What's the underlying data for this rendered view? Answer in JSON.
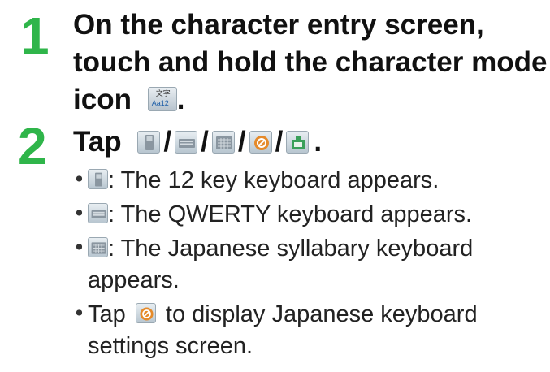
{
  "step1": {
    "number": "1",
    "line1": "On the character entry screen,",
    "line2": "touch and hold the character mode",
    "line3_prefix": "icon",
    "line3_suffix": ".",
    "icon_text_top": "文字",
    "icon_text_bottom": "Aa12"
  },
  "step2": {
    "number": "2",
    "title_prefix": "Tap",
    "separator": "/",
    "title_suffix": ".",
    "icons": [
      "12-key-keyboard-icon",
      "qwerty-keyboard-icon",
      "syllabary-keyboard-icon",
      "settings-icon",
      "plugin-icon"
    ]
  },
  "bullets": [
    {
      "dot": "・",
      "icon": "12-key-keyboard-icon",
      "text": ": The 12 key keyboard appears."
    },
    {
      "dot": "・",
      "icon": "qwerty-keyboard-icon",
      "text": ": The QWERTY keyboard appears."
    },
    {
      "dot": "・",
      "icon": "syllabary-keyboard-icon",
      "text_line1": ": The Japanese syllabary keyboard",
      "text_line2": "appears."
    },
    {
      "dot": "・",
      "prefix": "Tap",
      "icon": "settings-icon",
      "text_line1": "to display Japanese keyboard",
      "text_line2": "settings screen."
    }
  ],
  "colors": {
    "step_number": "#2fb54a",
    "settings_icon_bg": "#e58a2a",
    "plugin_icon_bg": "#3aa05a"
  }
}
